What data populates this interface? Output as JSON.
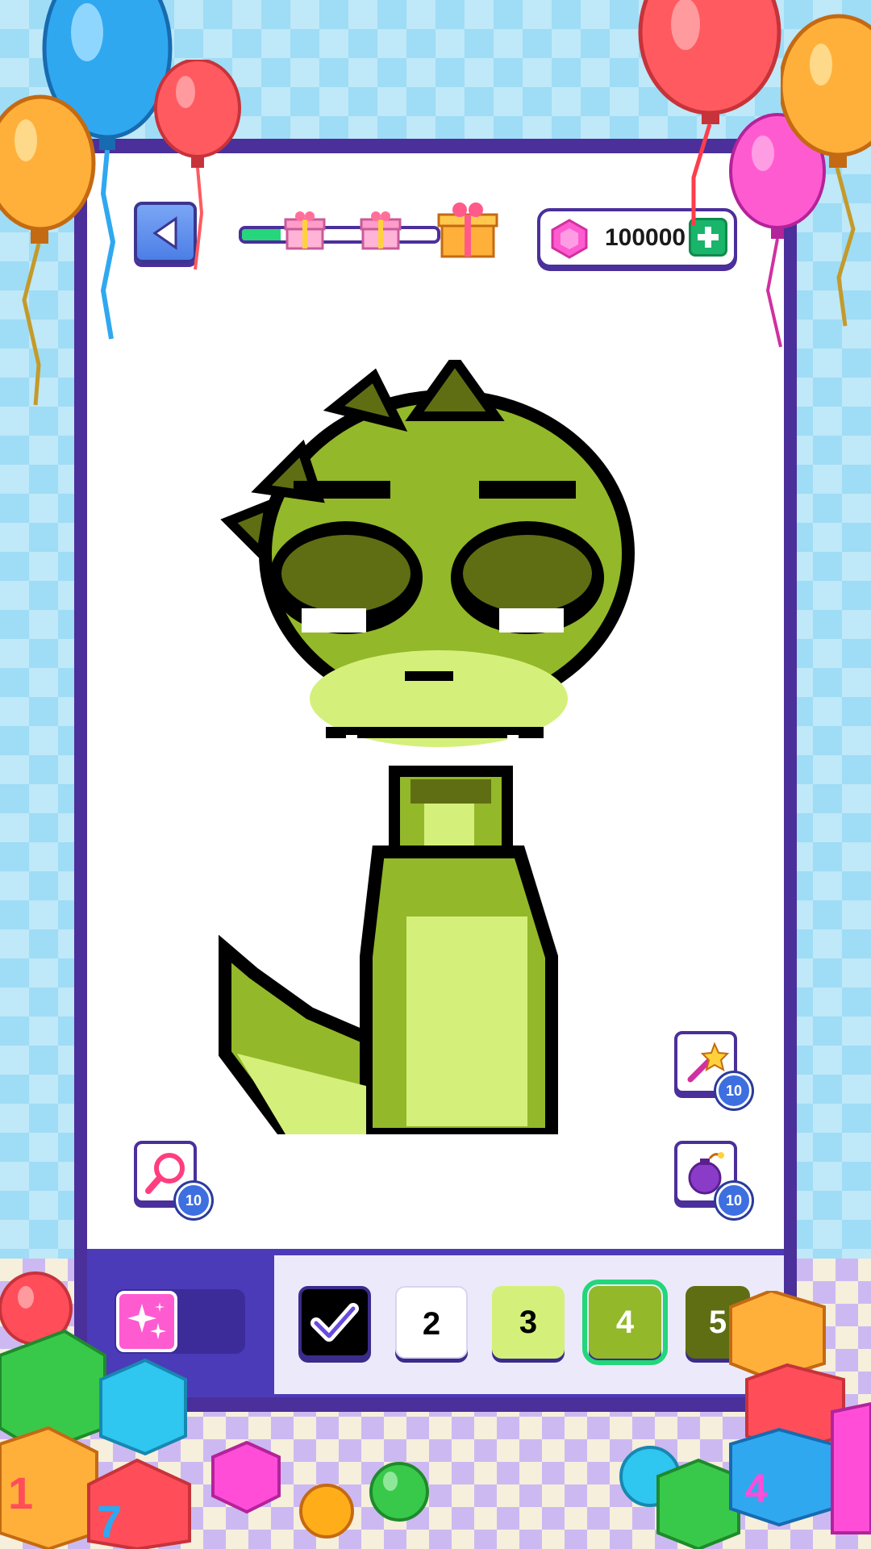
{
  "header": {
    "currency_amount": "100000",
    "level_progress": 0.2
  },
  "powerups": {
    "magic_wand_count": "10",
    "bomb_count": "10",
    "magnifier_count": "10"
  },
  "palette": {
    "swatches": [
      {
        "label": "",
        "color": "#000000",
        "completed": true
      },
      {
        "label": "2",
        "color": "#ffffff",
        "completed": false
      },
      {
        "label": "3",
        "color": "#d4f07a",
        "completed": false
      },
      {
        "label": "4",
        "color": "#93b82a",
        "completed": false,
        "selected": true
      },
      {
        "label": "5",
        "color": "#5f6e12",
        "completed": false
      }
    ]
  },
  "colors": {
    "frame": "#4b2f9a",
    "accent_green": "#22d67a",
    "gem_pink": "#ff5bd1"
  }
}
